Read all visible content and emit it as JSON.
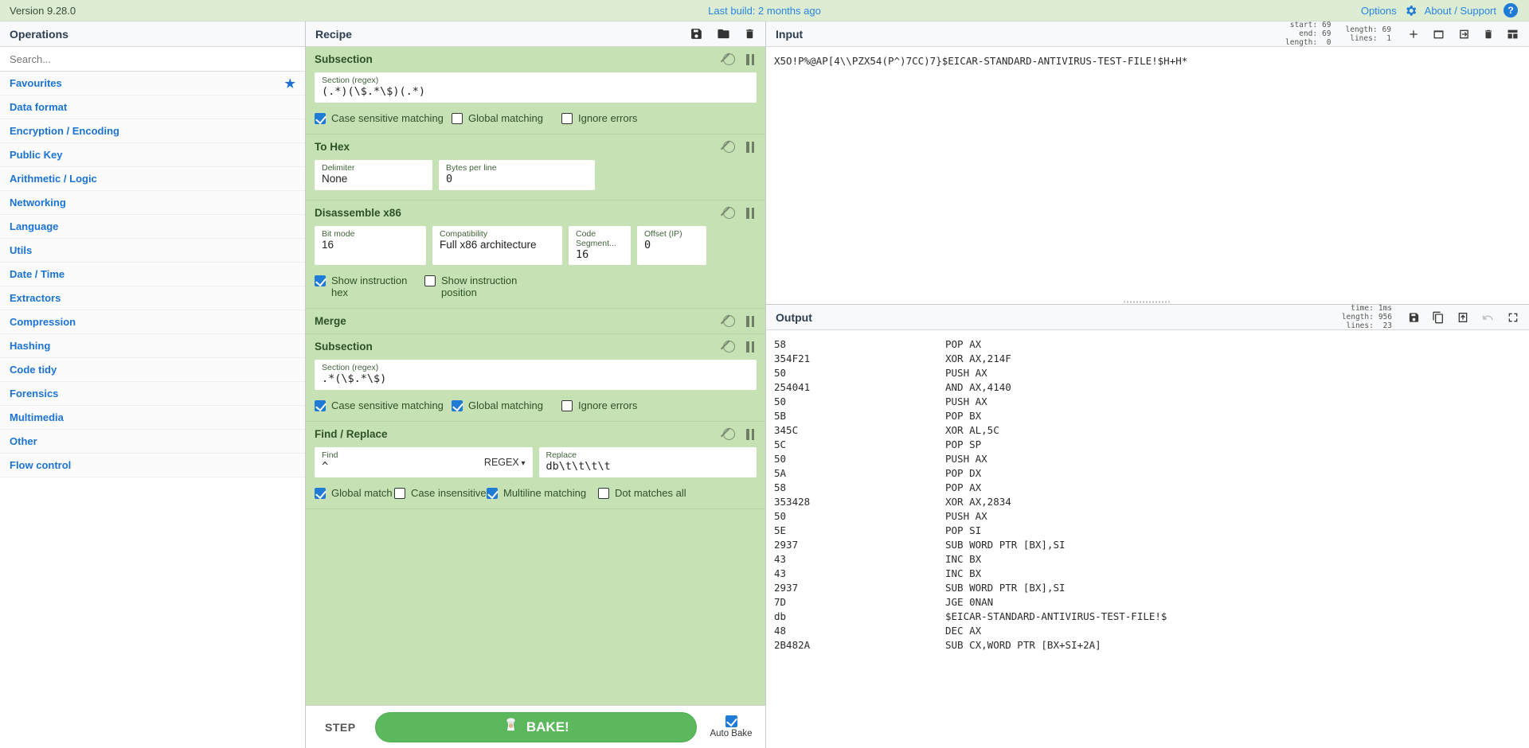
{
  "banner": {
    "version": "Version 9.28.0",
    "last_build": "Last build: 2 months ago",
    "options": "Options",
    "about": "About / Support",
    "gear_icon": "gear-icon",
    "help_icon": "question-circle-icon"
  },
  "operations": {
    "title": "Operations",
    "search_placeholder": "Search...",
    "search_value": "",
    "categories": [
      {
        "label": "Favourites",
        "starred": true
      },
      {
        "label": "Data format",
        "starred": false
      },
      {
        "label": "Encryption / Encoding",
        "starred": false
      },
      {
        "label": "Public Key",
        "starred": false
      },
      {
        "label": "Arithmetic / Logic",
        "starred": false
      },
      {
        "label": "Networking",
        "starred": false
      },
      {
        "label": "Language",
        "starred": false
      },
      {
        "label": "Utils",
        "starred": false
      },
      {
        "label": "Date / Time",
        "starred": false
      },
      {
        "label": "Extractors",
        "starred": false
      },
      {
        "label": "Compression",
        "starred": false
      },
      {
        "label": "Hashing",
        "starred": false
      },
      {
        "label": "Code tidy",
        "starred": false
      },
      {
        "label": "Forensics",
        "starred": false
      },
      {
        "label": "Multimedia",
        "starred": false
      },
      {
        "label": "Other",
        "starred": false
      },
      {
        "label": "Flow control",
        "starred": false
      }
    ]
  },
  "recipe": {
    "title": "Recipe",
    "header_icons": [
      "save-icon",
      "folder-icon",
      "trash-icon"
    ],
    "step_label": "STEP",
    "bake_label": "BAKE!",
    "bake_icon": "chef-icon",
    "auto_bake_label": "Auto Bake",
    "auto_bake_checked": true,
    "accent_green": "#5cb85c",
    "op_bg": "#c6e2b5",
    "operations": [
      {
        "name": "Subsection",
        "args": [
          {
            "label": "Section (regex)",
            "value": "(.*)(\\$.*\\$)(.*)",
            "mono": true
          }
        ],
        "checkboxes": [
          {
            "label": "Case sensitive matching",
            "checked": true
          },
          {
            "label": "Global matching",
            "checked": false
          },
          {
            "label": "Ignore errors",
            "checked": false
          }
        ]
      },
      {
        "name": "To Hex",
        "args": [
          {
            "label": "Delimiter",
            "value": "None",
            "mono": false
          },
          {
            "label": "Bytes per line",
            "value": "0",
            "mono": true
          }
        ],
        "checkboxes": []
      },
      {
        "name": "Disassemble x86",
        "args": [
          {
            "label": "Bit mode",
            "value": "16",
            "mono": false
          },
          {
            "label": "Compatibility",
            "value": "Full x86 architecture",
            "mono": false
          },
          {
            "label": "Code Segment...",
            "value": "16",
            "mono": true
          },
          {
            "label": "Offset (IP)",
            "value": "0",
            "mono": true
          }
        ],
        "checkboxes": [
          {
            "label": "Show instruction hex",
            "checked": true
          },
          {
            "label": "Show instruction position",
            "checked": false
          }
        ]
      },
      {
        "name": "Merge",
        "args": [],
        "checkboxes": []
      },
      {
        "name": "Subsection",
        "args": [
          {
            "label": "Section (regex)",
            "value": ".*(\\$.*\\$)",
            "mono": true
          }
        ],
        "checkboxes": [
          {
            "label": "Case sensitive matching",
            "checked": true
          },
          {
            "label": "Global matching",
            "checked": true
          },
          {
            "label": "Ignore errors",
            "checked": false
          }
        ]
      },
      {
        "name": "Find / Replace",
        "args": [
          {
            "label": "Find",
            "value": "^",
            "mono": true,
            "suffix": "REGEX"
          },
          {
            "label": "Replace",
            "value": "db\\t\\t\\t\\t",
            "mono": true
          }
        ],
        "checkboxes": [
          {
            "label": "Global match",
            "checked": true
          },
          {
            "label": "Case insensitive",
            "checked": false
          },
          {
            "label": "Multiline matching",
            "checked": true
          },
          {
            "label": "Dot matches all",
            "checked": false
          }
        ]
      }
    ]
  },
  "input": {
    "title": "Input",
    "counters_left": [
      {
        "key": "start:",
        "value": "69"
      },
      {
        "key": "end:",
        "value": "69"
      },
      {
        "key": "length:",
        "value": "0"
      }
    ],
    "counters_right": [
      {
        "key": "length:",
        "value": "69"
      },
      {
        "key": "lines:",
        "value": "1"
      }
    ],
    "icons": [
      "plus-icon",
      "folder-open-icon",
      "import-icon",
      "trash-icon",
      "layout-icon"
    ],
    "text": "X5O!P%@AP[4\\\\PZX54(P^)7CC)7}$EICAR-STANDARD-ANTIVIRUS-TEST-FILE!$H+H*"
  },
  "output": {
    "title": "Output",
    "counters": [
      {
        "key": "time:",
        "value": "1ms"
      },
      {
        "key": "length:",
        "value": "956"
      },
      {
        "key": "lines:",
        "value": "23"
      }
    ],
    "icons": [
      "save-icon",
      "copy-icon",
      "move-to-input-icon",
      "undo-icon",
      "maximise-icon"
    ],
    "lines": [
      {
        "hex": "58",
        "ins": "POP AX"
      },
      {
        "hex": "354F21",
        "ins": "XOR AX,214F"
      },
      {
        "hex": "50",
        "ins": "PUSH AX"
      },
      {
        "hex": "254041",
        "ins": "AND AX,4140"
      },
      {
        "hex": "50",
        "ins": "PUSH AX"
      },
      {
        "hex": "5B",
        "ins": "POP BX"
      },
      {
        "hex": "345C",
        "ins": "XOR AL,5C"
      },
      {
        "hex": "5C",
        "ins": "POP SP"
      },
      {
        "hex": "50",
        "ins": "PUSH AX"
      },
      {
        "hex": "5A",
        "ins": "POP DX"
      },
      {
        "hex": "58",
        "ins": "POP AX"
      },
      {
        "hex": "353428",
        "ins": "XOR AX,2834"
      },
      {
        "hex": "50",
        "ins": "PUSH AX"
      },
      {
        "hex": "5E",
        "ins": "POP SI"
      },
      {
        "hex": "2937",
        "ins": "SUB WORD PTR [BX],SI"
      },
      {
        "hex": "43",
        "ins": "INC BX"
      },
      {
        "hex": "43",
        "ins": "INC BX"
      },
      {
        "hex": "2937",
        "ins": "SUB WORD PTR [BX],SI"
      },
      {
        "hex": "7D",
        "ins": "JGE 0NAN"
      },
      {
        "hex": "db",
        "ins": "$EICAR-STANDARD-ANTIVIRUS-TEST-FILE!$"
      },
      {
        "hex": "48",
        "ins": "DEC AX"
      },
      {
        "hex": "2B482A",
        "ins": "SUB CX,WORD PTR [BX+SI+2A]"
      }
    ]
  }
}
